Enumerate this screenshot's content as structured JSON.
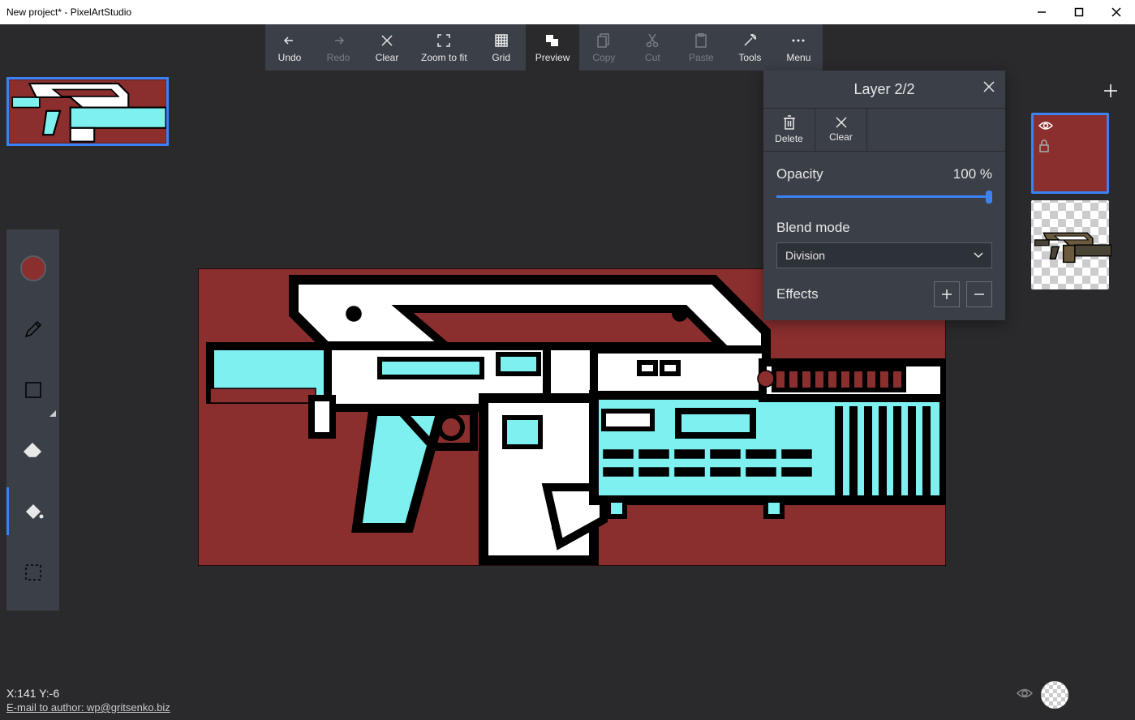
{
  "window": {
    "title": "New project* - PixelArtStudio"
  },
  "toolbar": {
    "undo": "Undo",
    "redo": "Redo",
    "clear": "Clear",
    "zoomfit": "Zoom to fit",
    "grid": "Grid",
    "preview": "Preview",
    "copy": "Copy",
    "cut": "Cut",
    "paste": "Paste",
    "tools": "Tools",
    "menu": "Menu"
  },
  "layerpanel": {
    "title": "Layer 2/2",
    "delete": "Delete",
    "clear": "Clear",
    "opacity_label": "Opacity",
    "opacity_value": "100 %",
    "blendmode_label": "Blend mode",
    "blendmode_value": "Division",
    "effects_label": "Effects"
  },
  "status": {
    "coords": "X:141 Y:-6",
    "email": "E-mail to author: wp@gritsenko.biz"
  },
  "colors": {
    "canvas_bg": "#8b2e2e",
    "accent": "#3b82f6",
    "cyan": "#7ef0f0"
  }
}
